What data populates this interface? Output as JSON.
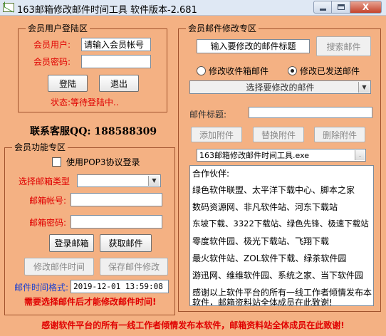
{
  "window": {
    "title": "163邮箱修改邮件时间工具 软件版本-2.681",
    "close_symbol": "X"
  },
  "login_group": {
    "title": "会员用户登陆区",
    "user_label": "会员用户:",
    "user_value": "请输入会员帐号",
    "password_label": "会员密码:",
    "password_value": "",
    "login_button": "登陆",
    "logout_button": "退出",
    "status": "状态:等待登陆中.."
  },
  "contact": "联系客服QQ: 188588309",
  "function_group": {
    "title": "会员功能专区",
    "pop3_checkbox": "使用POP3协议登录",
    "mailbox_type_label": "选择邮箱类型",
    "mailbox_type_value": "",
    "account_label": "邮箱帐号:",
    "account_value": "",
    "password_label": "邮箱密码:",
    "password_value": "",
    "login_mailbox_button": "登录邮箱",
    "fetch_mail_button": "获取邮件",
    "modify_time_button": "修改邮件时间",
    "save_mail_button": "保存邮件修改",
    "time_format_label": "邮件时间格式:",
    "time_value": "2019-12-01 13:59:08",
    "hint": "需要选择邮件后才能修改邮件时间!"
  },
  "mail_group": {
    "title": "会员邮件修改专区",
    "subject_input": "输入要修改的邮件标题",
    "search_button": "搜索邮件",
    "radio_inbox": "修改收件箱邮件",
    "radio_sent": "修改已发送邮件",
    "select_mail": "选择要修改的邮件",
    "subject_label": "邮件标题:",
    "subject_value": "",
    "add_attachment": "添加附件",
    "replace_attachment": "替换附件",
    "delete_attachment": "删除附件",
    "attachment_file": "163邮箱修改邮件时间工具.exe",
    "attachment_scroll": ".",
    "partners": [
      "合作伙伴:",
      "绿色软件联盟、太平洋下载中心、脚本之家",
      "数码资源网、非凡软件站、河东下载站",
      "东坡下载、3322下载站、绿色先锋、极速下载站",
      "零度软件园、极光下载站、飞翔下载",
      "最火软件站、ZOL软件下载、绿茶软件园",
      "游迅网、维维软件园、系统之家、当下软件园",
      "感谢以上软件平台的所有一线工作者倾情发布本",
      "软件，邮箱资料站全体成员在此致谢!"
    ]
  },
  "footer": "感谢软件平台的所有一线工作者倾情发布本软件，邮箱资料站全体成员在此致谢!"
}
